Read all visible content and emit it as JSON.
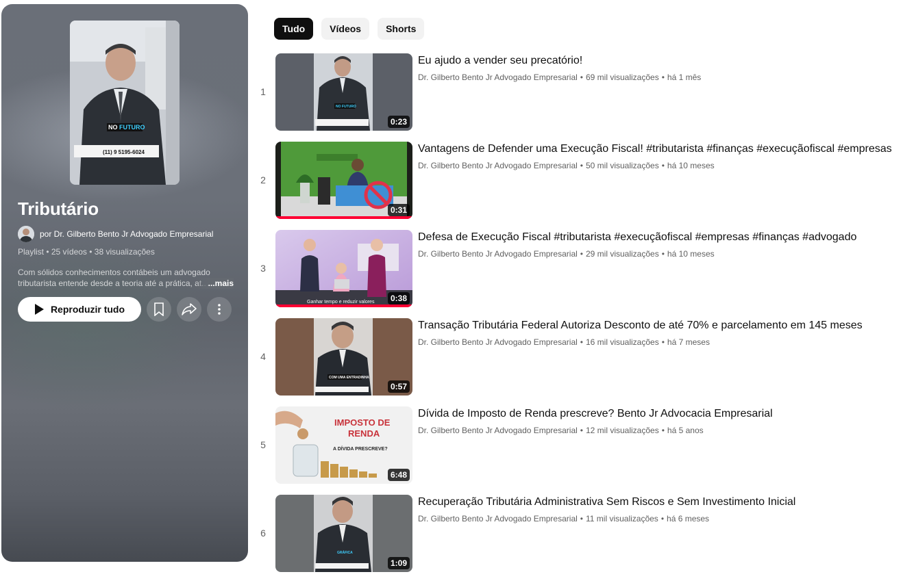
{
  "playlist": {
    "title": "Tributário",
    "owner": "por Dr. Gilberto Bento Jr Advogado Empresarial",
    "meta": "Playlist • 25 vídeos • 38 visualizações",
    "description": "Com sólidos conhecimentos contábeis um advogado tributarista entende desde a teoria até a prática, at...",
    "more_label": "...mais",
    "play_all_label": "Reproduzir tudo",
    "thumb_caption_a": "NO",
    "thumb_caption_b": "FUTURO",
    "thumb_phone": "(11) 9 5195-6024"
  },
  "chips": [
    {
      "label": "Tudo",
      "active": true
    },
    {
      "label": "Vídeos",
      "active": false
    },
    {
      "label": "Shorts",
      "active": false
    }
  ],
  "videos": [
    {
      "index": "1",
      "title": "Eu ajudo a vender seu precatório!",
      "channel": "Dr. Gilberto Bento Jr Advogado Empresarial",
      "views": "69 mil visualizações",
      "age": "há 1 mês",
      "duration": "0:23",
      "watched": false,
      "caption": "NO FUTURO"
    },
    {
      "index": "2",
      "title": "Vantagens de Defender uma Execução Fiscal! #tributarista #finanças #execuçãofiscal #empresas",
      "channel": "Dr. Gilberto Bento Jr Advogado Empresarial",
      "views": "50 mil visualizações",
      "age": "há 10 meses",
      "duration": "0:31",
      "watched": true
    },
    {
      "index": "3",
      "title": "Defesa de Execução Fiscal #tributarista #execuçãofiscal #empresas #finanças #advogado",
      "channel": "Dr. Gilberto Bento Jr Advogado Empresarial",
      "views": "29 mil visualizações",
      "age": "há 10 meses",
      "duration": "0:38",
      "watched": true,
      "caption": "Ganhar tempo e reduzir valores"
    },
    {
      "index": "4",
      "title": "Transação Tributária Federal Autoriza Desconto de até 70% e parcelamento em 145 meses",
      "channel": "Dr. Gilberto Bento Jr Advogado Empresarial",
      "views": "16 mil visualizações",
      "age": "há 7 meses",
      "duration": "0:57",
      "watched": false,
      "caption": "COM UMA ENTRADINHA"
    },
    {
      "index": "5",
      "title": "Dívida de Imposto de Renda prescreve? Bento Jr Advocacia Empresarial",
      "channel": "Dr. Gilberto Bento Jr Advogado Empresarial",
      "views": "12 mil visualizações",
      "age": "há 5 anos",
      "duration": "6:48",
      "watched": false,
      "caption_a": "IMPOSTO DE",
      "caption_b": "RENDA",
      "caption_c": "A DÍVIDA PRESCREVE?"
    },
    {
      "index": "6",
      "title": "Recuperação Tributária Administrativa Sem Riscos e Sem Investimento Inicial",
      "channel": "Dr. Gilberto Bento Jr Advogado Empresarial",
      "views": "11 mil visualizações",
      "age": "há 6 meses",
      "duration": "1:09",
      "watched": false,
      "caption": "GRÁFICA"
    }
  ],
  "colors": {
    "accent_red": "#ff0033",
    "chip_active_bg": "#0f0f0f",
    "chip_bg": "#f2f2f2",
    "meta_gray": "#606060"
  },
  "icons": {
    "play": "play-icon",
    "save": "bookmark-icon",
    "share": "share-arrow-icon",
    "more": "more-vertical-icon"
  }
}
